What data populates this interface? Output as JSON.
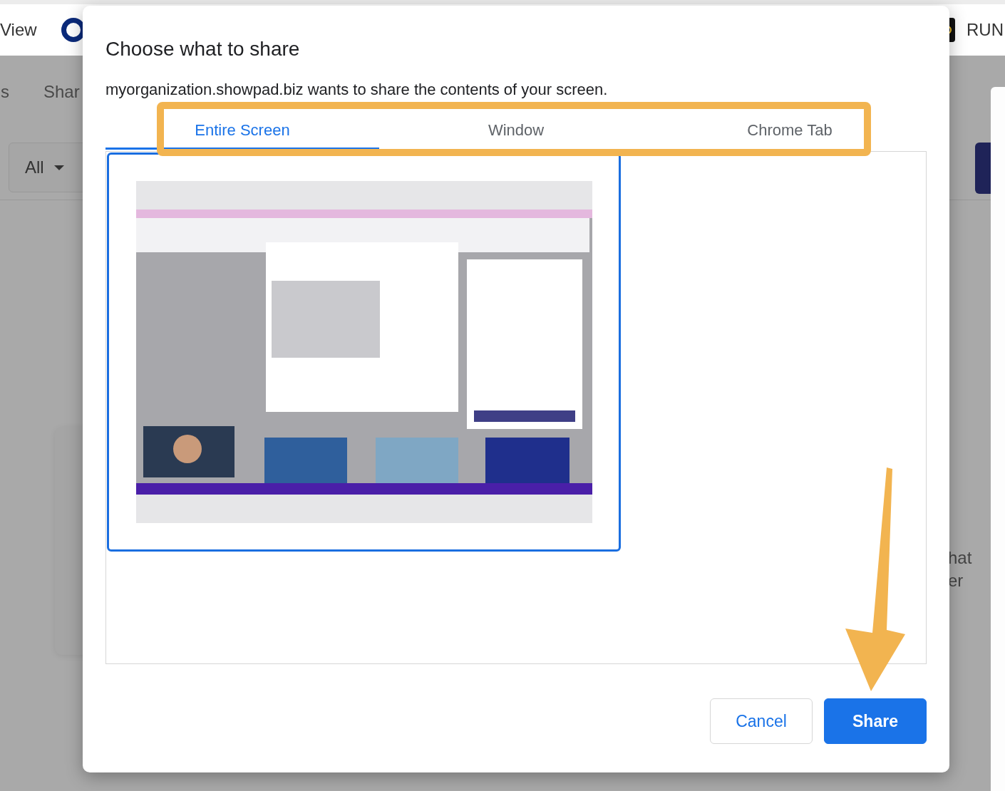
{
  "top_bar": {
    "left_text": "View",
    "right_text": "RUN"
  },
  "nav": {
    "items": [
      "s",
      "Shar"
    ]
  },
  "filter": {
    "value": "All"
  },
  "background_text": [
    "hat",
    "er"
  ],
  "dialog": {
    "title": "Choose what to share",
    "message": "myorganization.showpad.biz wants to share the contents of your screen.",
    "tabs": [
      {
        "label": "Entire Screen",
        "selected": true
      },
      {
        "label": "Window",
        "selected": false
      },
      {
        "label": "Chrome Tab",
        "selected": false
      }
    ],
    "sources": [
      {
        "kind": "picture",
        "selected": true
      }
    ],
    "buttons": [
      {
        "label": "Cancel",
        "kind": "secondary"
      },
      {
        "label": "Share",
        "kind": "primary"
      }
    ]
  }
}
